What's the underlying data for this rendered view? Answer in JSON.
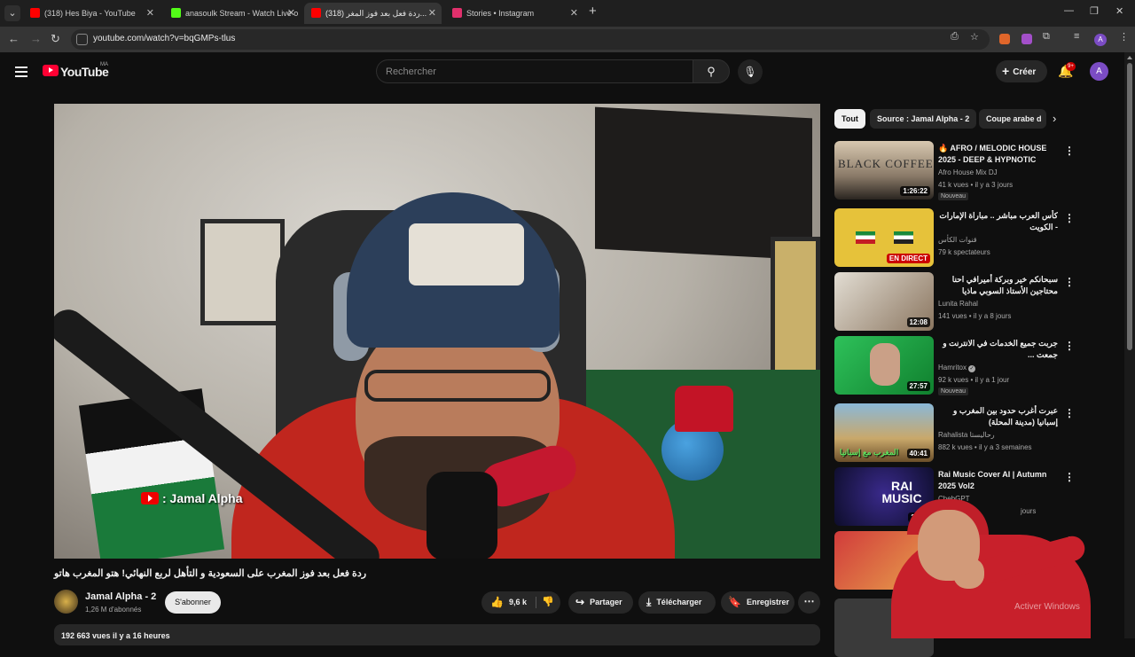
{
  "browser": {
    "tabs": [
      {
        "title": "(318) Hes Biya - YouTube",
        "favicon_color": "#ff0000",
        "active": false
      },
      {
        "title": "anasoulk Stream - Watch Live o",
        "favicon_color": "#53fc18",
        "active": false
      },
      {
        "title": "(318) ردة فعل بعد فوز المغر...",
        "favicon_color": "#ff0000",
        "active": true
      },
      {
        "title": "Stories • Instagram",
        "favicon_color": "#e1306c",
        "active": false
      }
    ],
    "new_tab_icon": "+",
    "url": "youtube.com/watch?v=bqGMPs-tlus",
    "profile_initial": "A"
  },
  "youtube": {
    "logo_text": "YouTube",
    "country_code": "MA",
    "search_placeholder": "Rechercher",
    "create_label": "Créer",
    "notif_count": "9+",
    "avatar_initial": "A"
  },
  "video": {
    "watermark": ": Jamal Alpha",
    "title": "ردة فعل بعد فوز المغرب على السعودية و التأهل لربع النهائي! هتو المغرب هاتو",
    "channel": "Jamal Alpha - 2",
    "subscribers": "1,26 M d'abonnés",
    "subscribe_label": "S'abonner",
    "likes": "9,6 k",
    "share_label": "Partager",
    "download_label": "Télécharger",
    "save_label": "Enregistrer",
    "views_and_date": "192 663 vues  il y a 16 heures"
  },
  "chips": [
    "Tout",
    "Source : Jamal Alpha - 2",
    "Coupe arabe d"
  ],
  "recommendations": [
    {
      "title": "🔥 AFRO / MELODIC HOUSE 2025 - DEEP & HYPNOTIC SET...",
      "channel": "Afro House Mix DJ",
      "meta": "41 k vues • il y a 3 jours",
      "duration": "1:26:22",
      "badge": "Nouveau",
      "thumb_text": "BLACK COFFEE",
      "rtl": false
    },
    {
      "title": "كأس العرب مباشر .. مباراة الإمارات - الكويت",
      "channel": "قنوات الكأس",
      "meta": "79 k spectateurs",
      "duration": "EN DIRECT",
      "badge": "",
      "rtl": true,
      "live": true
    },
    {
      "title": "سبحانكم خير وبركة أميرافي احنا محتاجين الأستاذ السوبي ماذيا ومحويا لمحاربة القناعة",
      "channel": "Lunita Rahal",
      "meta": "141 vues • il y a 8 jours",
      "duration": "12:08",
      "badge": "",
      "rtl": true
    },
    {
      "title": "جربت جميع الخدمات في الانترنت و جمعت ...",
      "channel": "Hamritox",
      "meta": "92 k vues • il y a 1 jour",
      "duration": "27:57",
      "badge": "Nouveau",
      "rtl": true,
      "verified": true
    },
    {
      "title": "عبرت أغرب حدود بين المغرب و إسبانيا (مدينة المحلة)",
      "channel": "Rahalista رحاليستا",
      "meta": "882 k vues • il y a 3 semaines",
      "duration": "40:41",
      "badge": "",
      "rtl": true,
      "thumb_text": "المغرب مع إسبانيا"
    },
    {
      "title": "Rai Music Cover AI | Autumn 2025 Vol2",
      "channel": "ChebGPT",
      "meta": "jours",
      "duration": "2:00:",
      "badge": "",
      "rtl": false,
      "thumb_text": "RAI MUSIC"
    },
    {
      "title": "",
      "channel": "",
      "meta": "",
      "duration": "",
      "badge": "",
      "rtl": true
    },
    {
      "title": "",
      "channel": "",
      "meta": "",
      "duration": "",
      "badge": "",
      "rtl": true
    }
  ],
  "os_watermark": "Activer Windows"
}
